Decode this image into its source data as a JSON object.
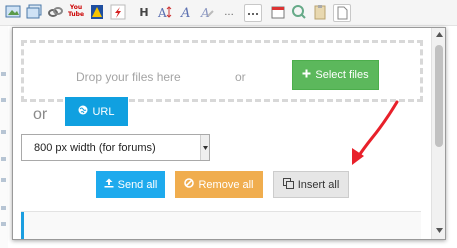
{
  "toolbar": {
    "youtube_label": "You\nTube",
    "icons": [
      "image-icon",
      "gallery-icon",
      "link-icon",
      "youtube-icon",
      "warning-icon",
      "flash-icon",
      "heading-icon",
      "font-size-icon",
      "font-icon",
      "clear-format-icon",
      "more-icon",
      "calendar-icon",
      "spellcheck-icon",
      "paste-icon",
      "page-icon"
    ]
  },
  "dropzone": {
    "text": "Drop your files here",
    "or": "or",
    "select_files": "Select files"
  },
  "url": {
    "or": "or",
    "label": "URL"
  },
  "size_select": {
    "value": "800 px width (for forums)"
  },
  "actions": {
    "send_all": "Send all",
    "remove_all": "Remove all",
    "insert_all": "Insert all"
  },
  "colors": {
    "green": "#5cb85c",
    "blue": "#10a0e0",
    "orange": "#f0ad4e",
    "gray": "#e6e6e6",
    "annotation": "#e8202a"
  }
}
